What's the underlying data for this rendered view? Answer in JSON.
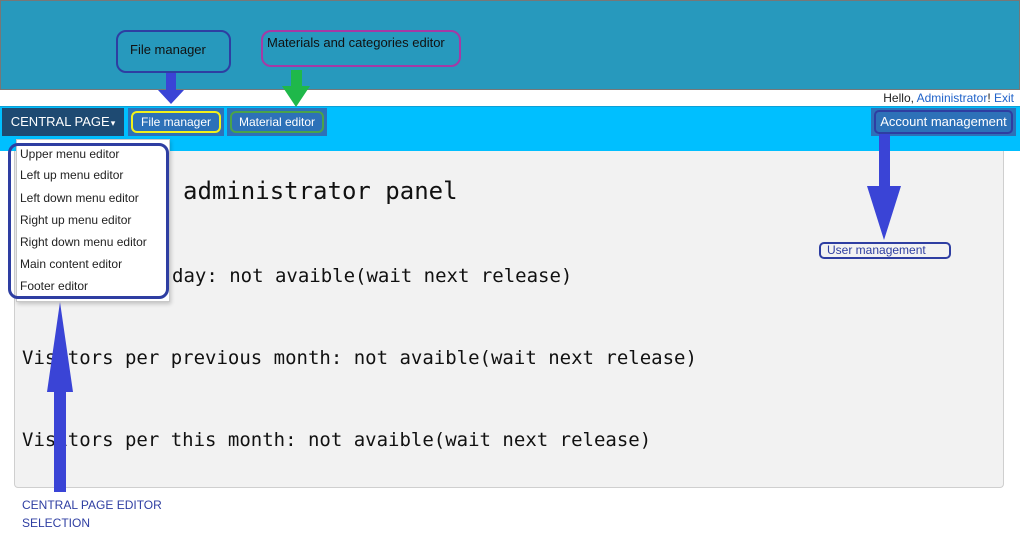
{
  "header": {
    "greeting": "Hello, ",
    "user_link": "Administrator",
    "bang": "! ",
    "exit_link": "Exit"
  },
  "nav": {
    "central_label": "CENTRAL PAGE",
    "central_caret": "▾",
    "files_label": "File manager",
    "material_label": "Material editor",
    "account_label": "Account management"
  },
  "dropdown": {
    "items": [
      {
        "label": "Upper menu editor"
      },
      {
        "label": "Left up menu editor"
      },
      {
        "label": "Left down menu editor"
      },
      {
        "label": "Right up menu editor"
      },
      {
        "label": "Right down menu editor"
      },
      {
        "label": "Main content editor"
      },
      {
        "label": "Footer editor"
      }
    ]
  },
  "panel": {
    "title": "administrator panel",
    "stats": [
      "day: not avaible(wait next release)",
      "Visitors per previous month: not avaible(wait next release)",
      "Visitors per this month: not avaible(wait next release)"
    ]
  },
  "annotations": {
    "files": "File manager",
    "materials": "Materials and categories editor",
    "users": "User management",
    "central_line1": "CENTRAL PAGE EDITOR",
    "central_line2": "SELECTION"
  },
  "colors": {
    "header": "#2799bd",
    "nav_bar": "#00bfff",
    "nav_active": "#1e4a72",
    "nav_button": "#2d71b8",
    "annotation_arrow": "#3a44d6",
    "annotation_arrow_green": "#1fb84a"
  },
  "icons": {
    "arrow_down": "arrow-down-icon",
    "arrow_up": "arrow-up-icon"
  }
}
